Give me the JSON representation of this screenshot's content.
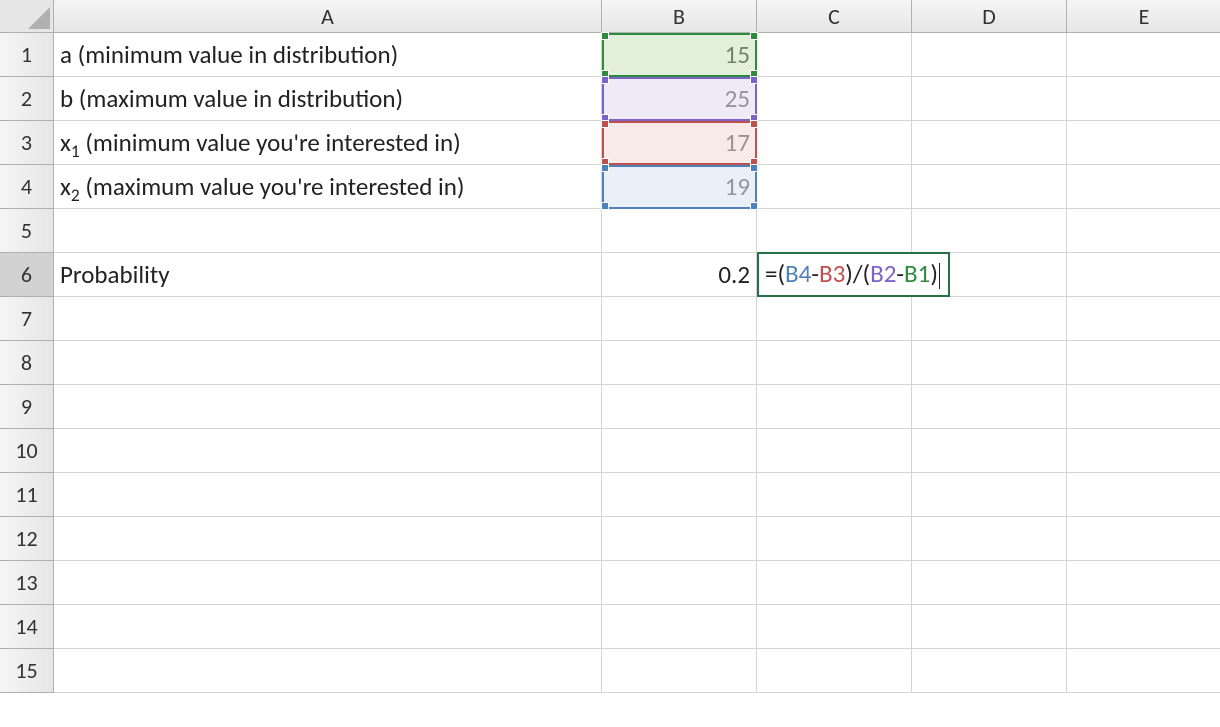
{
  "columns": [
    "A",
    "B",
    "C",
    "D",
    "E"
  ],
  "rows": [
    "1",
    "2",
    "3",
    "4",
    "5",
    "6",
    "7",
    "8",
    "9",
    "10",
    "11",
    "12",
    "13",
    "14",
    "15"
  ],
  "cells": {
    "A1": {
      "text": "a (minimum value in distribution)"
    },
    "A2": {
      "text": "b (maximum value in distribution)"
    },
    "A3": {
      "prefix": "x",
      "sub": "1",
      "suffix": " (minimum value you're interested in)"
    },
    "A4": {
      "prefix": "x",
      "sub": "2",
      "suffix": " (maximum value you're interested in)"
    },
    "A6": {
      "text": "Probability"
    },
    "B1": {
      "text": "15"
    },
    "B2": {
      "text": "25"
    },
    "B3": {
      "text": "17"
    },
    "B4": {
      "text": "19"
    },
    "B6": {
      "text": "0.2"
    }
  },
  "ref_highlights": [
    {
      "cell": "B1",
      "color": "green"
    },
    {
      "cell": "B2",
      "color": "purple"
    },
    {
      "cell": "B3",
      "color": "red"
    },
    {
      "cell": "B4",
      "color": "blue"
    }
  ],
  "active_cell": "C6",
  "formula_parts": [
    {
      "t": "=",
      "cls": "eq"
    },
    {
      "t": "(",
      "cls": "op"
    },
    {
      "t": "B4",
      "cls": "ref-b4"
    },
    {
      "t": "-",
      "cls": "op"
    },
    {
      "t": "B3",
      "cls": "ref-b3"
    },
    {
      "t": ")",
      "cls": "op"
    },
    {
      "t": "/",
      "cls": "op"
    },
    {
      "t": "(",
      "cls": "op"
    },
    {
      "t": "B2",
      "cls": "ref-b2"
    },
    {
      "t": "-",
      "cls": "op"
    },
    {
      "t": "B1",
      "cls": "ref-b1"
    },
    {
      "t": ")",
      "cls": "op"
    }
  ],
  "formula_plain": "=(B4-B3)/(B2-B1)"
}
